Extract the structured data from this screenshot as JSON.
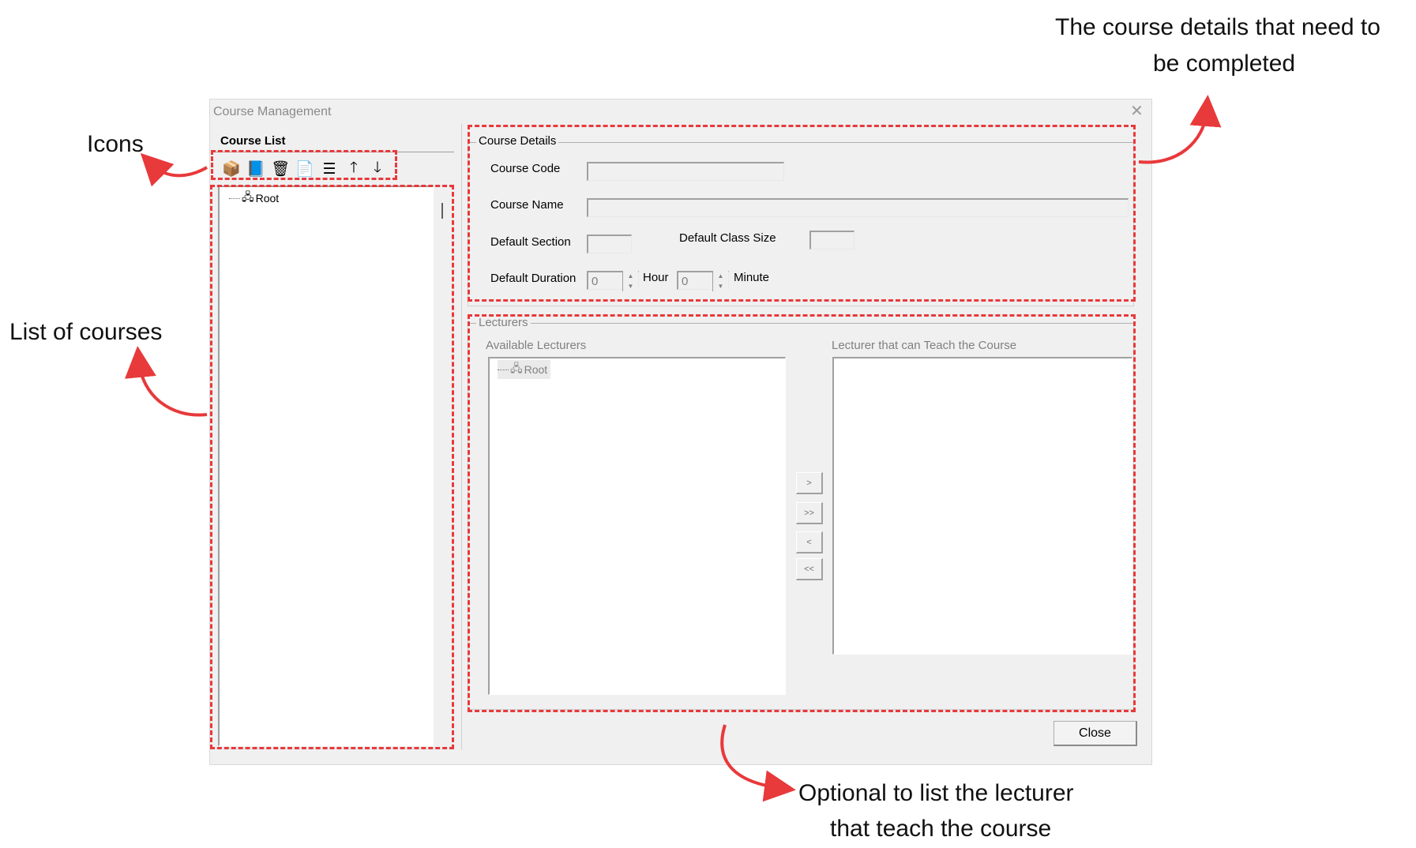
{
  "window": {
    "title": "Course Management",
    "close_icon": "close-icon"
  },
  "course_list": {
    "heading": "Course List",
    "toolbar": [
      {
        "name": "new-course-icon",
        "glyph": "📦"
      },
      {
        "name": "book-icon",
        "glyph": "📘"
      },
      {
        "name": "delete-icon",
        "glyph": "🗑"
      },
      {
        "name": "properties-icon",
        "glyph": "📄"
      },
      {
        "name": "list-icon",
        "glyph": "☰"
      },
      {
        "name": "move-up-icon",
        "glyph": "🡑"
      },
      {
        "name": "move-down-icon",
        "glyph": "🡓"
      }
    ],
    "tree_root": "Root"
  },
  "course_details": {
    "group_label": "Course Details",
    "course_code_label": "Course Code",
    "course_code_value": "",
    "course_name_label": "Course Name",
    "course_name_value": "",
    "default_section_label": "Default Section",
    "default_section_value": "",
    "default_class_size_label": "Default Class Size",
    "default_class_size_value": "",
    "default_duration_label": "Default Duration",
    "hour_value": "0",
    "hour_label": "Hour",
    "minute_value": "0",
    "minute_label": "Minute"
  },
  "lecturers": {
    "group_label": "Lecturers",
    "available_label": "Available Lecturers",
    "available_root": "Root",
    "assigned_label": "Lecturer that can Teach the Course",
    "buttons": {
      "add": ">",
      "add_all": ">>",
      "remove": "<",
      "remove_all": "<<"
    }
  },
  "close_button": "Close",
  "annotations": {
    "icons": "Icons",
    "list_of_courses": "List of courses",
    "course_details_line1": "The course details that need to",
    "course_details_line2": "be completed",
    "lecturers_line1": "Optional to list the lecturer",
    "lecturers_line2": "that teach the course"
  },
  "colors": {
    "annotation_red": "#e8393b",
    "window_bg": "#f0f0f0"
  }
}
